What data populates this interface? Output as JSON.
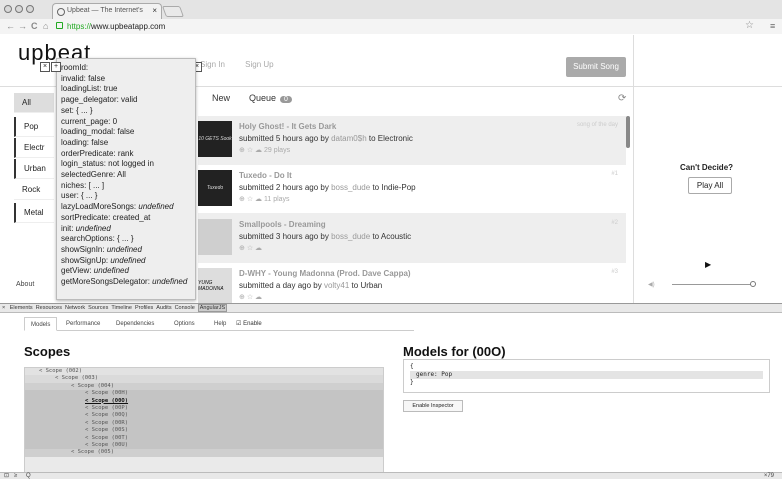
{
  "browser": {
    "tab_title": "Upbeat — The Internet's",
    "tab_close": "×",
    "url_scheme": "https://",
    "url_host": "www.upbeatapp.com",
    "back_glyph": "←",
    "forward_glyph": "→",
    "reload_glyph": "C",
    "home_glyph": "⌂",
    "menu_glyph": "≡",
    "star_glyph": "☆"
  },
  "header": {
    "logo": "upbeat",
    "sign_in_text": "Sign In",
    "sign_up_text": "Sign Up",
    "submit_button": "Submit Song"
  },
  "sidebar": {
    "genres": [
      "All",
      "Pop",
      "Electr",
      "Urban",
      "Rock",
      "Metal"
    ],
    "about": "About"
  },
  "feed": {
    "tab_new": "New",
    "tab_queue": "Queue",
    "queue_count": "0",
    "refresh_glyph": "⟳",
    "songs": [
      {
        "thumb": "10 GETS Sook",
        "title": "Holy Ghost! - It Gets Dark",
        "meta_prefix": "submitted 5 hours ago by ",
        "user": "datam0$h",
        "meta_mid": " to ",
        "genre": "Electronic",
        "plays": "29 plays",
        "rank": "song of the day",
        "selected": true
      },
      {
        "thumb": "Tuxedo",
        "title": "Tuxedo - Do It",
        "meta_prefix": "submitted 2 hours ago by ",
        "user": "boss_dude",
        "meta_mid": " to ",
        "genre": "Indie-Pop",
        "plays": "11 plays",
        "rank": "#1",
        "selected": false
      },
      {
        "thumb": "",
        "title": "Smallpools - Dreaming",
        "meta_prefix": "submitted 3 hours ago by ",
        "user": "boss_dude",
        "meta_mid": " to ",
        "genre": "Acoustic",
        "plays": "",
        "rank": "#2",
        "selected": true
      },
      {
        "thumb": "YUNG MADONNA",
        "title": "D-WHY - Young Madonna (Prod. Dave Cappa)",
        "meta_prefix": "submitted a day ago by ",
        "user": "volty41",
        "meta_mid": " to ",
        "genre": "Urban",
        "plays": "",
        "rank": "#3",
        "selected": false
      }
    ]
  },
  "player": {
    "cant_decide": "Can't Decide?",
    "play_all": "Play All",
    "play_glyph": "▶",
    "volume_glyph": "◀)"
  },
  "scope_popup": {
    "lines": [
      "roomId:",
      "invalid: false",
      "loadingList: true",
      "page_delegator: valid",
      "set: { ... }",
      "current_page: 0",
      "loading_modal: false",
      "loading: false",
      "orderPredicate: rank",
      "login_status: not logged in",
      "selectedGenre: All",
      "niches: [ ... ]",
      "user: { ... }"
    ],
    "undefined_lines": [
      {
        "key": "lazyLoadMoreSongs: ",
        "val": "undefined"
      },
      {
        "key": "sortPredicate: created_at",
        "val": ""
      },
      {
        "key": "init: ",
        "val": "undefined"
      },
      {
        "key": "searchOptions: { ... }",
        "val": ""
      },
      {
        "key": "showSignIn: ",
        "val": "undefined"
      },
      {
        "key": "showSignUp: ",
        "val": "undefined"
      },
      {
        "key": "getView: ",
        "val": "undefined"
      },
      {
        "key": "getMoreSongsDelegator: ",
        "val": "undefined"
      }
    ]
  },
  "devtools": {
    "panels": [
      "Elements",
      "Resources",
      "Network",
      "Sources",
      "Timeline",
      "Profiles",
      "Audits",
      "Console",
      "AngularJS"
    ],
    "sub_tabs": [
      "Models",
      "Performance",
      "Dependencies",
      "Options",
      "Help"
    ],
    "enable_label": "Enable",
    "scopes_title": "Scopes",
    "models_title": "Models for (00O)",
    "scope_tree": [
      {
        "text": "< Scope (002)",
        "level": 1,
        "sel": false
      },
      {
        "text": "< Scope (003)",
        "level": 2,
        "sel": false
      },
      {
        "text": "< Scope (004)",
        "level": 3,
        "sel": false
      },
      {
        "text": "< Scope (00H)",
        "level": 4,
        "sel": false
      },
      {
        "text": "< Scope (00O)",
        "level": 4,
        "sel": true
      },
      {
        "text": "< Scope (00P)",
        "level": 4,
        "sel": false
      },
      {
        "text": "< Scope (00Q)",
        "level": 4,
        "sel": false
      },
      {
        "text": "< Scope (00R)",
        "level": 4,
        "sel": false
      },
      {
        "text": "< Scope (00S)",
        "level": 4,
        "sel": false
      },
      {
        "text": "< Scope (00T)",
        "level": 4,
        "sel": false
      },
      {
        "text": "< Scope (00U)",
        "level": 4,
        "sel": false
      },
      {
        "text": "< Scope (005)",
        "level": 3,
        "sel": false
      }
    ],
    "model_open": "{",
    "model_line": "genre: Pop",
    "model_close": "}",
    "enable_inspector": "Enable Inspector",
    "status_left": "Q",
    "status_right": "×79"
  }
}
